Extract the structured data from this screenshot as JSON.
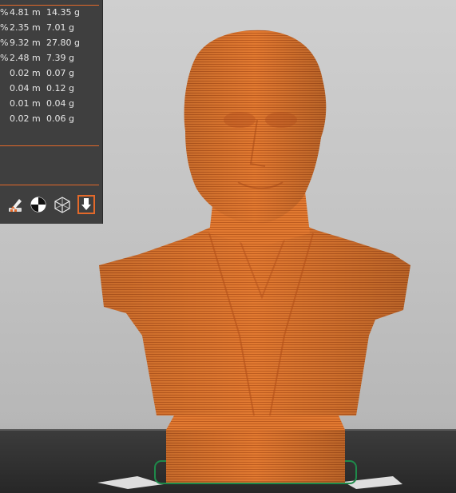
{
  "stats": {
    "rows": [
      {
        "pct": "%",
        "length": "4.81 m",
        "weight": "14.35 g"
      },
      {
        "pct": "%",
        "length": "2.35 m",
        "weight": "7.01 g"
      },
      {
        "pct": "%",
        "length": "9.32 m",
        "weight": "27.80 g"
      },
      {
        "pct": "%",
        "length": "2.48 m",
        "weight": "7.39 g"
      },
      {
        "pct": "",
        "length": "0.02 m",
        "weight": "0.07 g"
      },
      {
        "pct": "",
        "length": "0.04 m",
        "weight": "0.12 g"
      },
      {
        "pct": "",
        "length": "0.01 m",
        "weight": "0.04 g"
      },
      {
        "pct": "",
        "length": "0.02 m",
        "weight": "0.06 g"
      }
    ]
  },
  "toolbar": {
    "icons": [
      "paint-brush-icon",
      "contrast-circle-icon",
      "wireframe-cube-icon",
      "export-arrow-icon"
    ]
  },
  "colors": {
    "accent": "#e3692a",
    "model": "#e0782f",
    "model_line": "#b4541c",
    "panel": "#3f3f3f",
    "bed": "#2e2e2e",
    "skirt": "#1e8a4a"
  }
}
